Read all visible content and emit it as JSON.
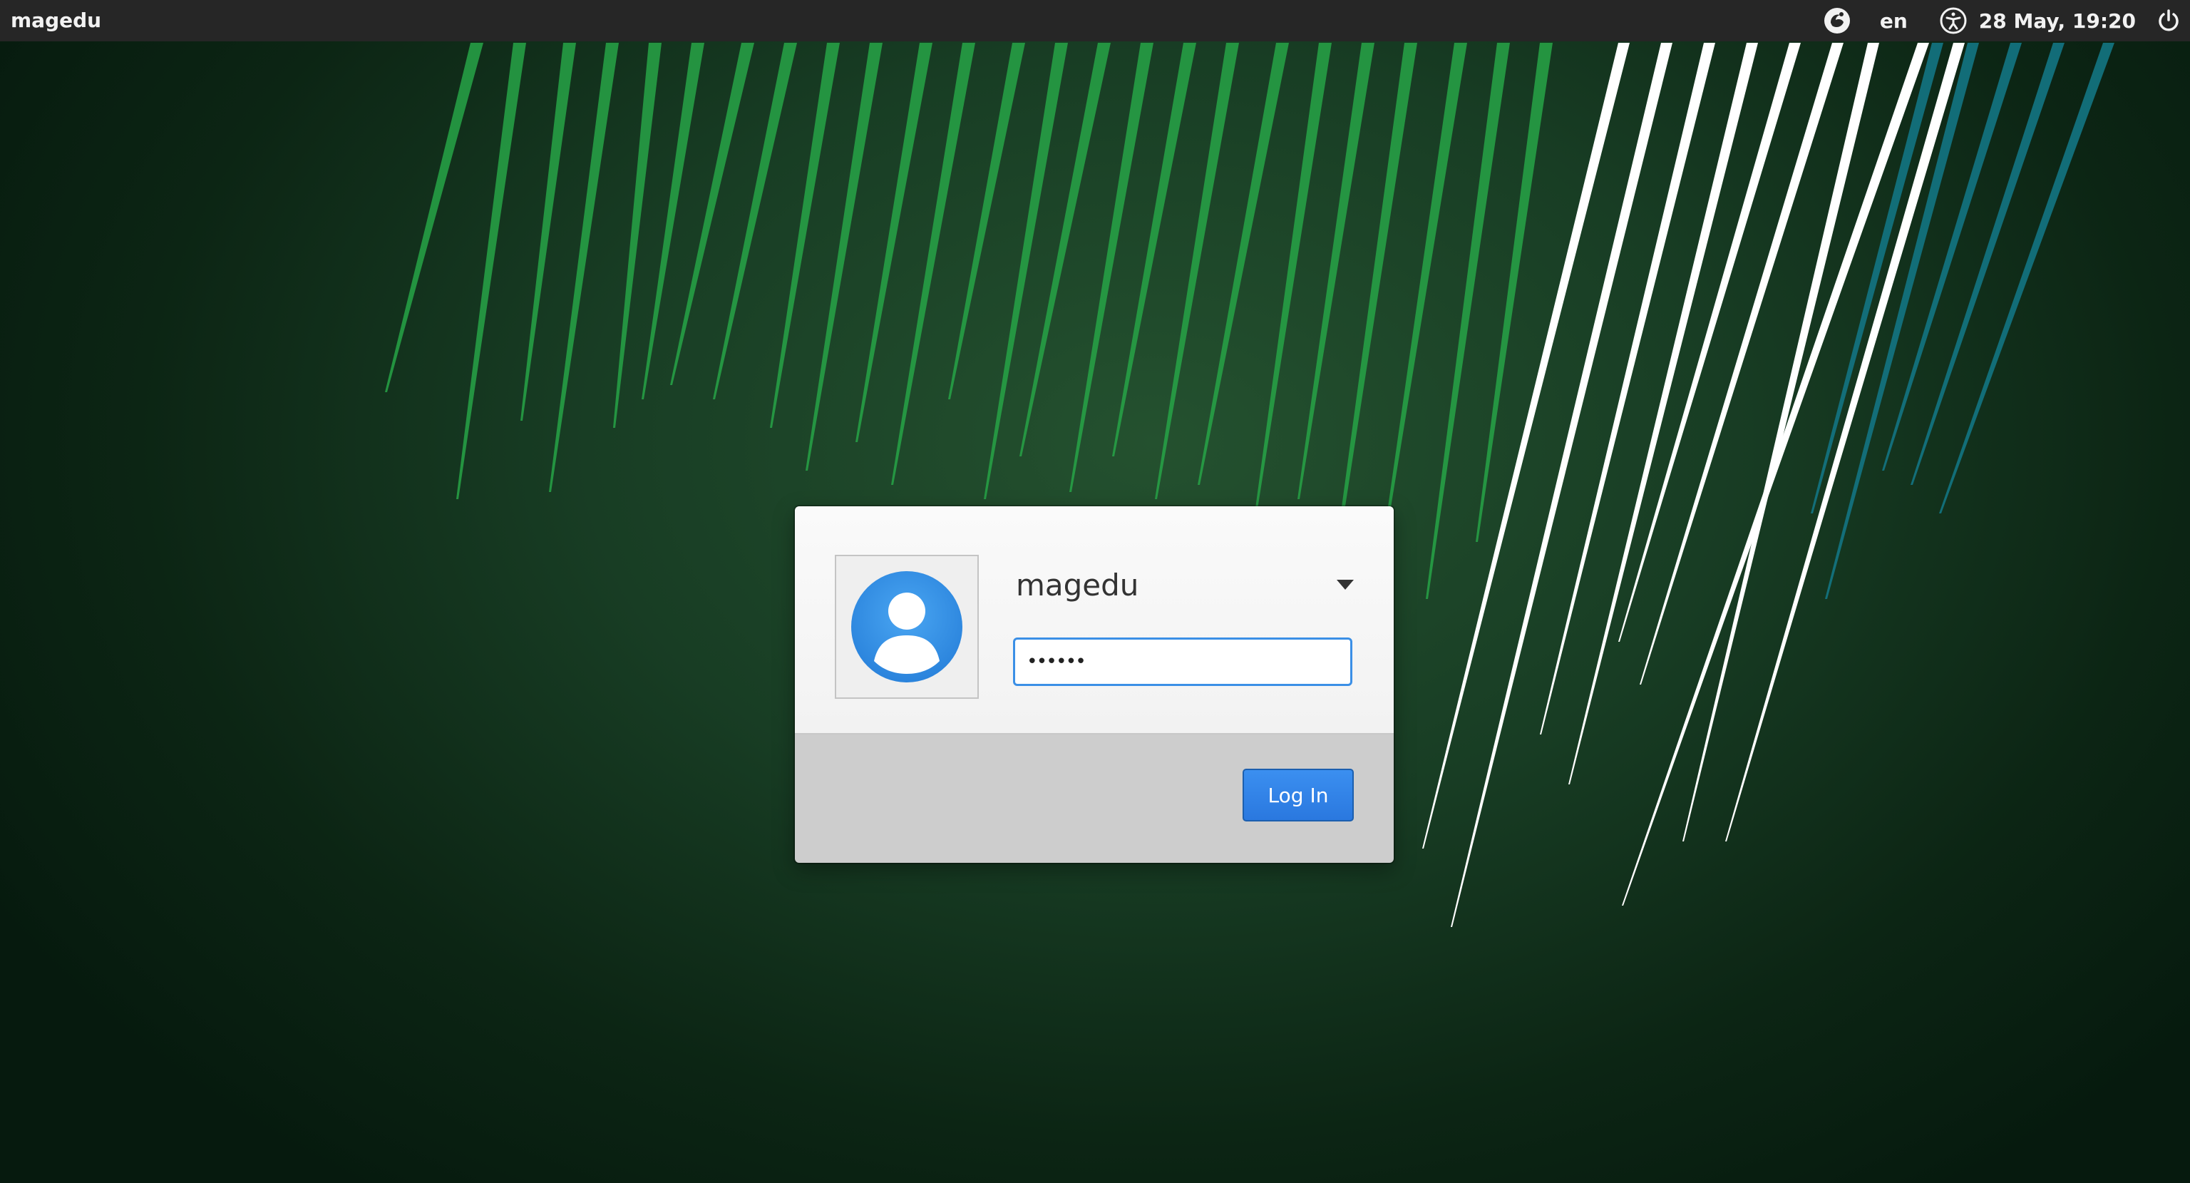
{
  "topbar": {
    "hostname": "magedu",
    "keyboard_layout": "en",
    "datetime": "28 May, 19:20",
    "icons": {
      "session": "session-icon",
      "accessibility": "accessibility-icon",
      "power": "power-icon"
    }
  },
  "login": {
    "user_name": "magedu",
    "password_value": "••••••",
    "login_button_label": "Log In",
    "icons": {
      "avatar": "user-avatar-icon",
      "user_menu": "chevron-down-icon"
    }
  },
  "colors": {
    "topbar_bg": "#262626",
    "accent": "#2a7fe6",
    "background_dark": "#0c2514",
    "stripe_green": "#27a447",
    "stripe_white": "#ffffff",
    "stripe_teal": "#137583"
  }
}
